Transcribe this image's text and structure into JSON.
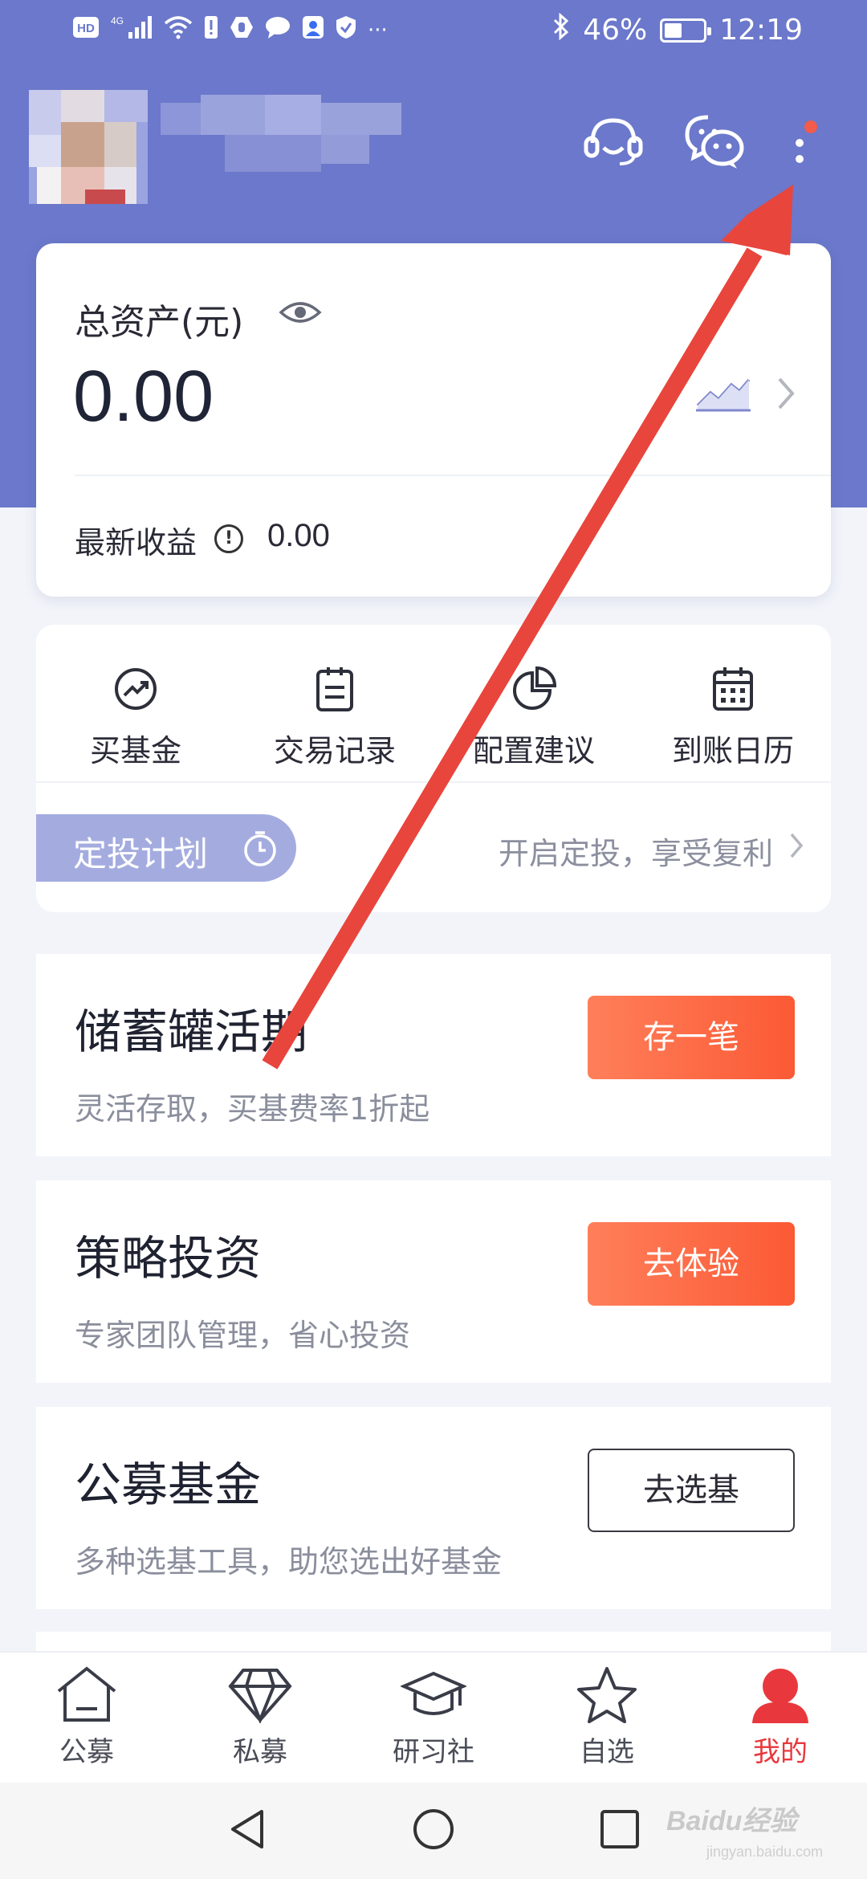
{
  "status_bar": {
    "left_icons": [
      "hd-icon",
      "4g-signal-icon",
      "wifi-icon",
      "alert-icon",
      "hand-icon",
      "message-icon",
      "contact-icon",
      "shield-icon",
      "more-dots"
    ],
    "hd": "HD",
    "net": "4G",
    "more": "···",
    "bluetooth_icon": "bluetooth-icon",
    "battery_text": "46%",
    "battery_level": 0.46,
    "time": "12:19"
  },
  "header": {
    "icons": [
      "customer-service-icon",
      "chat-icon",
      "more-menu-icon"
    ],
    "notification_dot_color": "#f35b4a",
    "brand_color": "#6b78cb"
  },
  "asset": {
    "label": "总资产(元)",
    "value": "0.00",
    "income_label": "最新收益",
    "info_icon": "ⓘ",
    "income_value": "0.00"
  },
  "quick_menu": {
    "items": [
      {
        "label": "买基金",
        "icon": "trend-icon"
      },
      {
        "label": "交易记录",
        "icon": "clipboard-icon"
      },
      {
        "label": "配置建议",
        "icon": "pie-chart-icon"
      },
      {
        "label": "到账日历",
        "icon": "calendar-icon"
      }
    ],
    "plan_label": "定投计划",
    "plan_hint": "开启定投，享受复利"
  },
  "products": [
    {
      "title": "储蓄罐活期",
      "subtitle": "灵活存取，买基费率1折起",
      "button": "存一笔",
      "style": "orange"
    },
    {
      "title": "策略投资",
      "subtitle": "专家团队管理，省心投资",
      "button": "去体验",
      "style": "orange"
    },
    {
      "title": "公募基金",
      "subtitle": "多种选基工具，助您选出好基金",
      "button": "去选基",
      "style": "outline"
    }
  ],
  "bottom_nav": {
    "items": [
      {
        "label": "公募",
        "icon": "home-icon",
        "active": false
      },
      {
        "label": "私募",
        "icon": "diamond-icon",
        "active": false
      },
      {
        "label": "研习社",
        "icon": "graduation-cap-icon",
        "active": false
      },
      {
        "label": "自选",
        "icon": "star-icon",
        "active": false
      },
      {
        "label": "我的",
        "icon": "profile-icon",
        "active": true
      }
    ],
    "active_color": "#e8383d"
  },
  "system_nav": [
    "back-icon",
    "home-circle-icon",
    "recent-apps-icon"
  ],
  "watermark": {
    "text": "Baidu经验",
    "sub": "jingyan.baidu.com"
  }
}
